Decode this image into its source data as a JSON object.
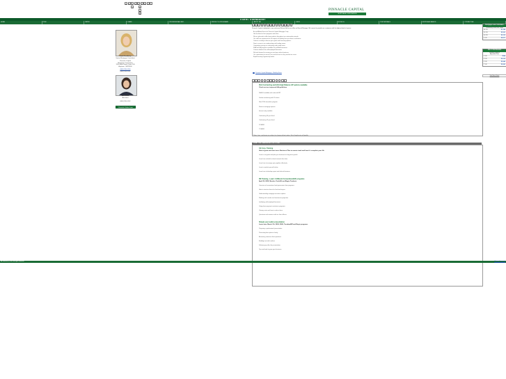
{
  "letters_row1": [
    "A",
    "B",
    "C",
    "D",
    "E",
    "F",
    "G",
    "H",
    "I"
  ],
  "letters_col": [
    "J",
    "K",
    "L",
    "M"
  ],
  "logo": {
    "name": "PINNACLE CAPITAL",
    "tagline": "MORTGAGE CORPORATION"
  },
  "title_band": "CAROL CORNBERRY",
  "nav": [
    "HOME",
    "ITEM",
    "RATES",
    "LOANS",
    "PROFESSIONAL INFO",
    "PRODUCT & PROGRAMS",
    "ABOUT ME",
    "LINKS",
    "MY BLOG",
    "TESTIMONIALS",
    "MORTGAGE BASICS",
    "CONTACT ME"
  ],
  "agent": {
    "name": "Carol Cornberry",
    "title": "Senior Mortgage Consultant",
    "company": "Pinnacle Capital",
    "dept": "Mortgage Corporation",
    "address": "1200 Main Street, Suite 100",
    "city": "Anytown, CA 95000",
    "phone": "(800) 555-0100",
    "fax": "(800) 555-0101"
  },
  "assistant": {
    "name": "Sara Miller",
    "role": "Assistant",
    "phone": "(800) 555-0102"
  },
  "left_button": "Pinnacle Online Loan",
  "main": {
    "intro_title": "Pinnacle Capital is delighted to now welcome Michael Hall to our office as Branch Manager. We commit to provide our customers with the highest level of service.",
    "intro_lines": [
      "As an Affiliate Branch of Pinnacle Capital Mortgage Corp.:",
      "Get the latest in loan programs and rates.",
      "We are pleased to offer loan products throughout our nationwide network.",
      "Our staff are experienced in all aspects of lending from purchase to refinance.",
      "Contact us today to discuss your goals and financing options.",
      "Direct access to our underwriting and funding teams.",
      "Competitive pricing on conforming and jumbo loans.",
      "FHA and VA programs available for qualified borrowers.",
      "Custom solutions for self-employed borrowers.",
      "We look forward to serving you and your referral partners.",
      "Our commitment to service has earned trust in every market we serve.",
      "Equal Housing Opportunity lender."
    ],
    "link_text": "Pinnacle Capital Mortgage - Monthly News",
    "section_bar": "WHAT THE TRAINING ACTOR TODAY",
    "feature_title": "FHA Contracting and HOA High Balance HP options available",
    "feature_sub": "Check out our improved HA guidelines",
    "feature_lines": [
      "FHA 30 available with reduced MIP",
      "Jumbo conforming with 5% down",
      "New 203k streamline program",
      "Reverse mortgage options",
      "Interest only available",
      "Conforming 30 year fixed",
      "Conforming 15 year fixed",
      "5/1 ARM",
      "7/1 ARM"
    ],
    "disclaimer": "Rates, fees, and terms are subject to change without notice. Not all applicants will qualify.",
    "s1_title": "CE Corp. Training",
    "s1_sub": "How to grow and react ours: Business Plan to master track and how it's complete your life",
    "s1_lines": [
      "Learn to set goals and plan your business for long-term growth",
      "Learn how to build a referral network that lasts",
      "Learn how to manage your pipeline effectively",
      "Learn to market yourself online",
      "Learn how to develop repeat and referral business"
    ],
    "s2_title": "RE Training - Learn 4 different Conventional/HF programs",
    "s2_sub": "April 29, 2009, Member Tools/Hf and Begin Products",
    "s2_lines": [
      "Overview of conventional and government loan programs",
      "How to structure loans for first-time buyers",
      "Understanding mortgage insurance options",
      "Working with condos and investment properties",
      "Qualifying self-employed borrowers",
      "Using down payment assistance programs",
      "Closing costs and how to reduce them",
      "Questions and answers with our loan officers"
    ],
    "s3_title": "Simple your realtor presentation",
    "s3_sub": "Learn how: March 7th, 2009, 2009, Tuesday/AR and Begin programs",
    "s3_lines": [
      "Preparing a professional presentation",
      "Presenting loan options clearly",
      "Answering common client questions",
      "Building trust with realtors",
      "Following up after the presentation",
      "Tips and tools to grow your business"
    ]
  },
  "rates": {
    "widget1": {
      "header": "Mortgage Loan Calculator",
      "sub": "Conforming Fixed Rate Loans",
      "rows": [
        {
          "label": "30 YR",
          "value": "$1,199"
        },
        {
          "label": "15 YR",
          "value": "$1,531"
        },
        {
          "label": "10 YR",
          "value": "$2,113"
        },
        {
          "label": "5 YR",
          "value": "$3,871"
        }
      ]
    },
    "widget2": {
      "header": "ADJ STRATEGIES",
      "sub": "Monthly Payment",
      "sub2": "Adjustable Rate",
      "rows": [
        {
          "label": "1 YR",
          "value": "$994"
        },
        {
          "label": "3 YR",
          "value": "$1,012"
        },
        {
          "label": "5 YR",
          "value": "$1,043"
        },
        {
          "label": "7 YR",
          "value": "$1,081"
        }
      ]
    },
    "widget3_link": "See More Rates"
  },
  "footer": {
    "left": "All contents (c) 2009. All rights reserved.",
    "right": "Website Design by"
  }
}
